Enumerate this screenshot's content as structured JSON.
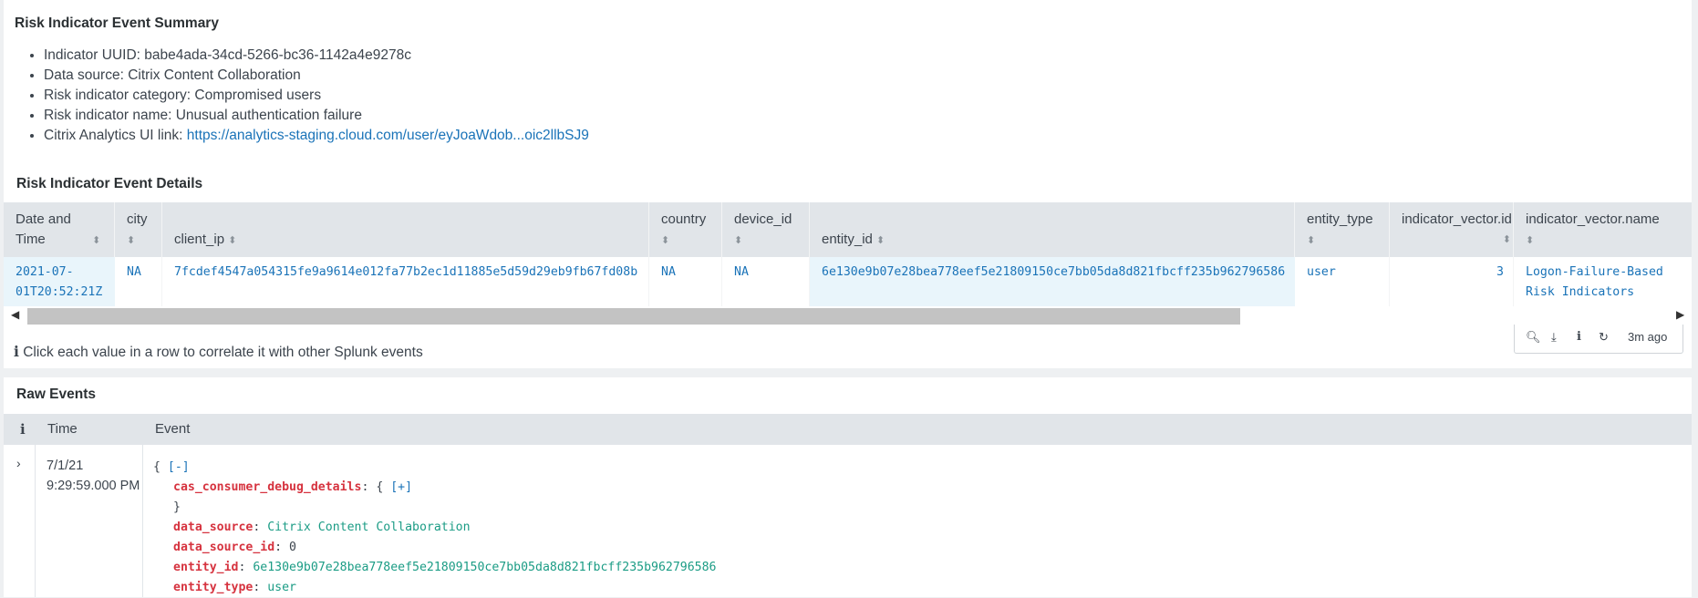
{
  "summary": {
    "title": "Risk Indicator Event Summary",
    "items": [
      {
        "label": "Indicator UUID: ",
        "value": "babe4ada-34cd-5266-bc36-1142a4e9278c"
      },
      {
        "label": "Data source: ",
        "value": "Citrix Content Collaboration"
      },
      {
        "label": "Risk indicator category: ",
        "value": "Compromised users"
      },
      {
        "label": "Risk indicator name: ",
        "value": "Unusual authentication failure"
      },
      {
        "label": "Citrix Analytics UI link: ",
        "value": "https://analytics-staging.cloud.com/user/eyJoaWdob...oic2llbSJ9"
      }
    ]
  },
  "details": {
    "title": "Risk Indicator Event Details",
    "columns": [
      {
        "header": "Date and Time",
        "value": "2021-07-01T20:52:21Z"
      },
      {
        "header": "city",
        "value": "NA"
      },
      {
        "header": "client_ip",
        "value": "7fcdef4547a054315fe9a9614e012fa77b2ec1d11885e5d59d29eb9fb67fd08b"
      },
      {
        "header": "country",
        "value": "NA"
      },
      {
        "header": "device_id",
        "value": "NA"
      },
      {
        "header": "entity_id",
        "value": "6e130e9b07e28bea778eef5e21809150ce7bb05da8d821fbcff235b962796586"
      },
      {
        "header": "entity_type",
        "value": "user"
      },
      {
        "header": "indicator_vector.id",
        "value": "3"
      },
      {
        "header": "indicator_vector.name",
        "value": "Logon-Failure-Based Risk Indicators"
      }
    ],
    "note": "Click each value in a row to correlate it with other Splunk events",
    "updated": "3m ago",
    "sort_glyph": "⬍"
  },
  "raw": {
    "title": "Raw Events",
    "headers": {
      "info": "i",
      "time": "Time",
      "event": "Event"
    },
    "event": {
      "date": "7/1/21",
      "time": "9:29:59.000 PM",
      "open_brace": "{",
      "collapse": "[-]",
      "expand": "[+]",
      "close_inner": "}",
      "fields": [
        {
          "key": "cas_consumer_debug_details",
          "value": "{ ",
          "kind": "object"
        },
        {
          "key": "data_source",
          "value": "Citrix Content Collaboration",
          "kind": "string"
        },
        {
          "key": "data_source_id",
          "value": "0",
          "kind": "number"
        },
        {
          "key": "entity_id",
          "value": "6e130e9b07e28bea778eef5e21809150ce7bb05da8d821fbcff235b962796586",
          "kind": "string"
        },
        {
          "key": "entity_type",
          "value": "user",
          "kind": "string"
        }
      ]
    }
  }
}
